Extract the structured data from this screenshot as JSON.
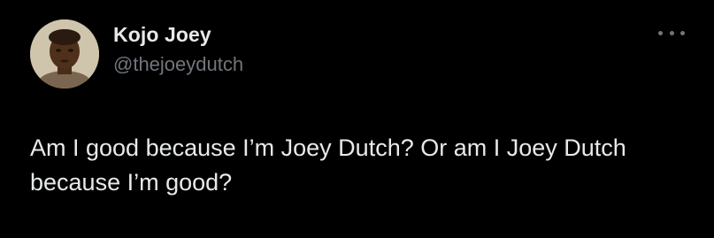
{
  "tweet": {
    "author": {
      "name": "Kojo Joey",
      "handle": "@thejoeydutch"
    },
    "text": "Am I good because I’m Joey Dutch? Or am I Joey Dutch because I’m good?",
    "more_icon": "more-horizontal-icon"
  },
  "colors": {
    "background": "#000000",
    "primary_text": "#e7e9ea",
    "secondary_text": "#71767b"
  }
}
